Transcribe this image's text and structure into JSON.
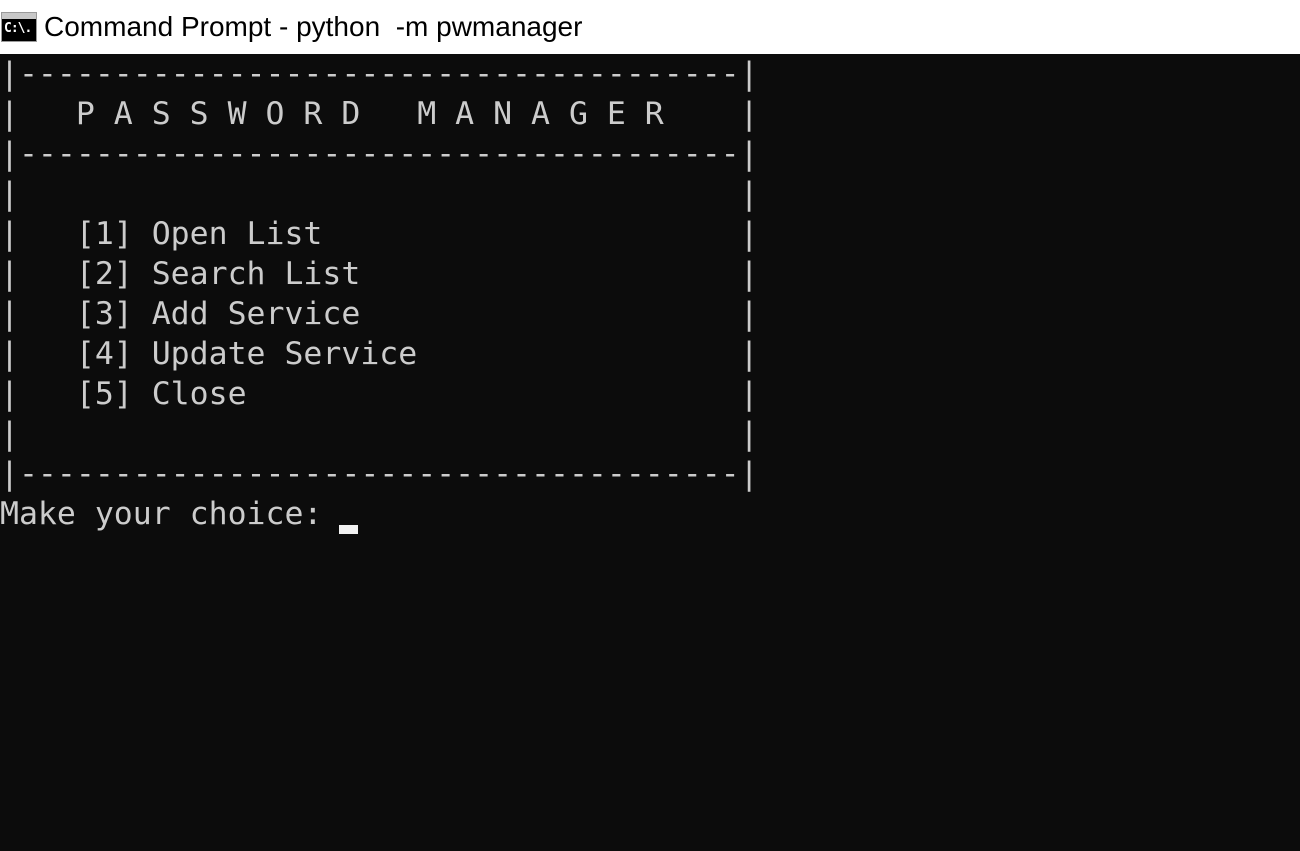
{
  "window": {
    "title": "Command Prompt - python  -m pwmanager",
    "icon": "cmd-prompt-icon",
    "icon_glyph": "C:\\."
  },
  "console": {
    "lines": [
      "|--------------------------------------|",
      "|   P A S S W O R D   M A N A G E R    |",
      "|--------------------------------------|",
      "|                                      |",
      "|   [1] Open List                      |",
      "|   [2] Search List                    |",
      "|   [3] Add Service                    |",
      "|   [4] Update Service                 |",
      "|   [5] Close                          |",
      "|                                      |",
      "|--------------------------------------|",
      "Make your choice: "
    ]
  },
  "colors": {
    "console_background": "#0c0c0c",
    "console_text": "#cccccc",
    "titlebar_background": "#ffffff"
  }
}
